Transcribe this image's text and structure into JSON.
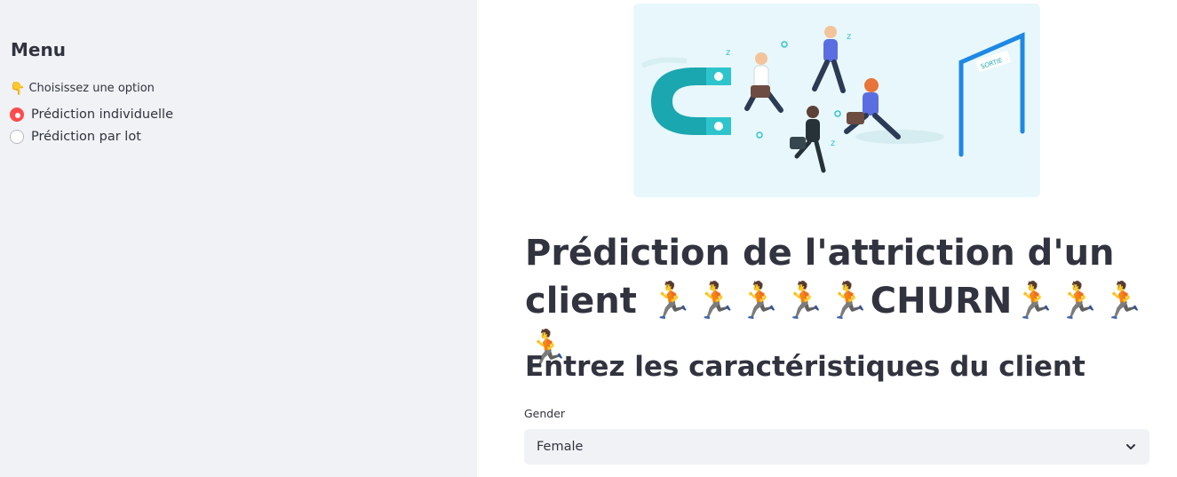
{
  "sidebar": {
    "title": "Menu",
    "radio_label": "Choisissez une option",
    "radio_label_icon": "pointing-hand-icon",
    "options": [
      {
        "label": "Prédiction individuelle",
        "selected": true
      },
      {
        "label": "Prédiction par lot",
        "selected": false
      }
    ]
  },
  "banner": {
    "sign_text": "SORTIE"
  },
  "main": {
    "title": "Prédiction de l'attriction d'un client 🏃🏃🏃🏃🏃CHURN🏃🏃🏃🏃",
    "subtitle": "Entrez les caractéristiques du client",
    "gender_label": "Gender",
    "gender_value": "Female"
  },
  "colors": {
    "accent": "#ff4b4b",
    "sidebar_bg": "#f0f2f6",
    "banner_bg": "#e8f7fb",
    "magnet": "#1aa7b0",
    "door": "#1e88e5"
  }
}
